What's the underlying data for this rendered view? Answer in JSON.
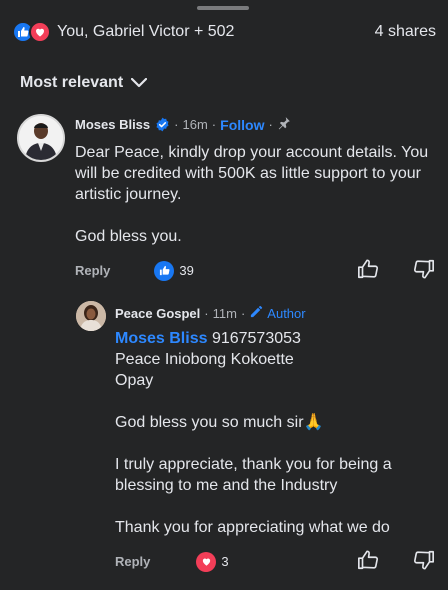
{
  "header": {
    "reactions_text": "You, Gabriel Victor + 502",
    "shares_text": "4 shares"
  },
  "sort": {
    "label": "Most relevant"
  },
  "comment": {
    "author": "Moses Bliss",
    "time": "16m",
    "follow_label": "Follow",
    "paragraphs": [
      "Dear Peace, kindly drop your account details. You will be credited with 500K as little support to your artistic journey.",
      "God bless you."
    ],
    "reply_label": "Reply",
    "reaction_count": "39"
  },
  "reply": {
    "author": "Peace Gospel",
    "time": "11m",
    "author_badge": "Author",
    "mention": "Moses Bliss",
    "lines": [
      "9167573053",
      "Peace Iniobong Kokoette",
      "Opay"
    ],
    "paragraphs": [
      "God bless you so much sir🙏",
      "I truly appreciate, thank you for being a blessing to me and the Industry",
      "Thank you for appreciating what we do"
    ],
    "reply_label": "Reply",
    "reaction_count": "3"
  },
  "colors": {
    "background": "#242526",
    "text": "#e4e6eb",
    "secondary": "#b0b3b8",
    "accent": "#2d88ff",
    "like": "#1877f2",
    "love": "#f33e58"
  }
}
